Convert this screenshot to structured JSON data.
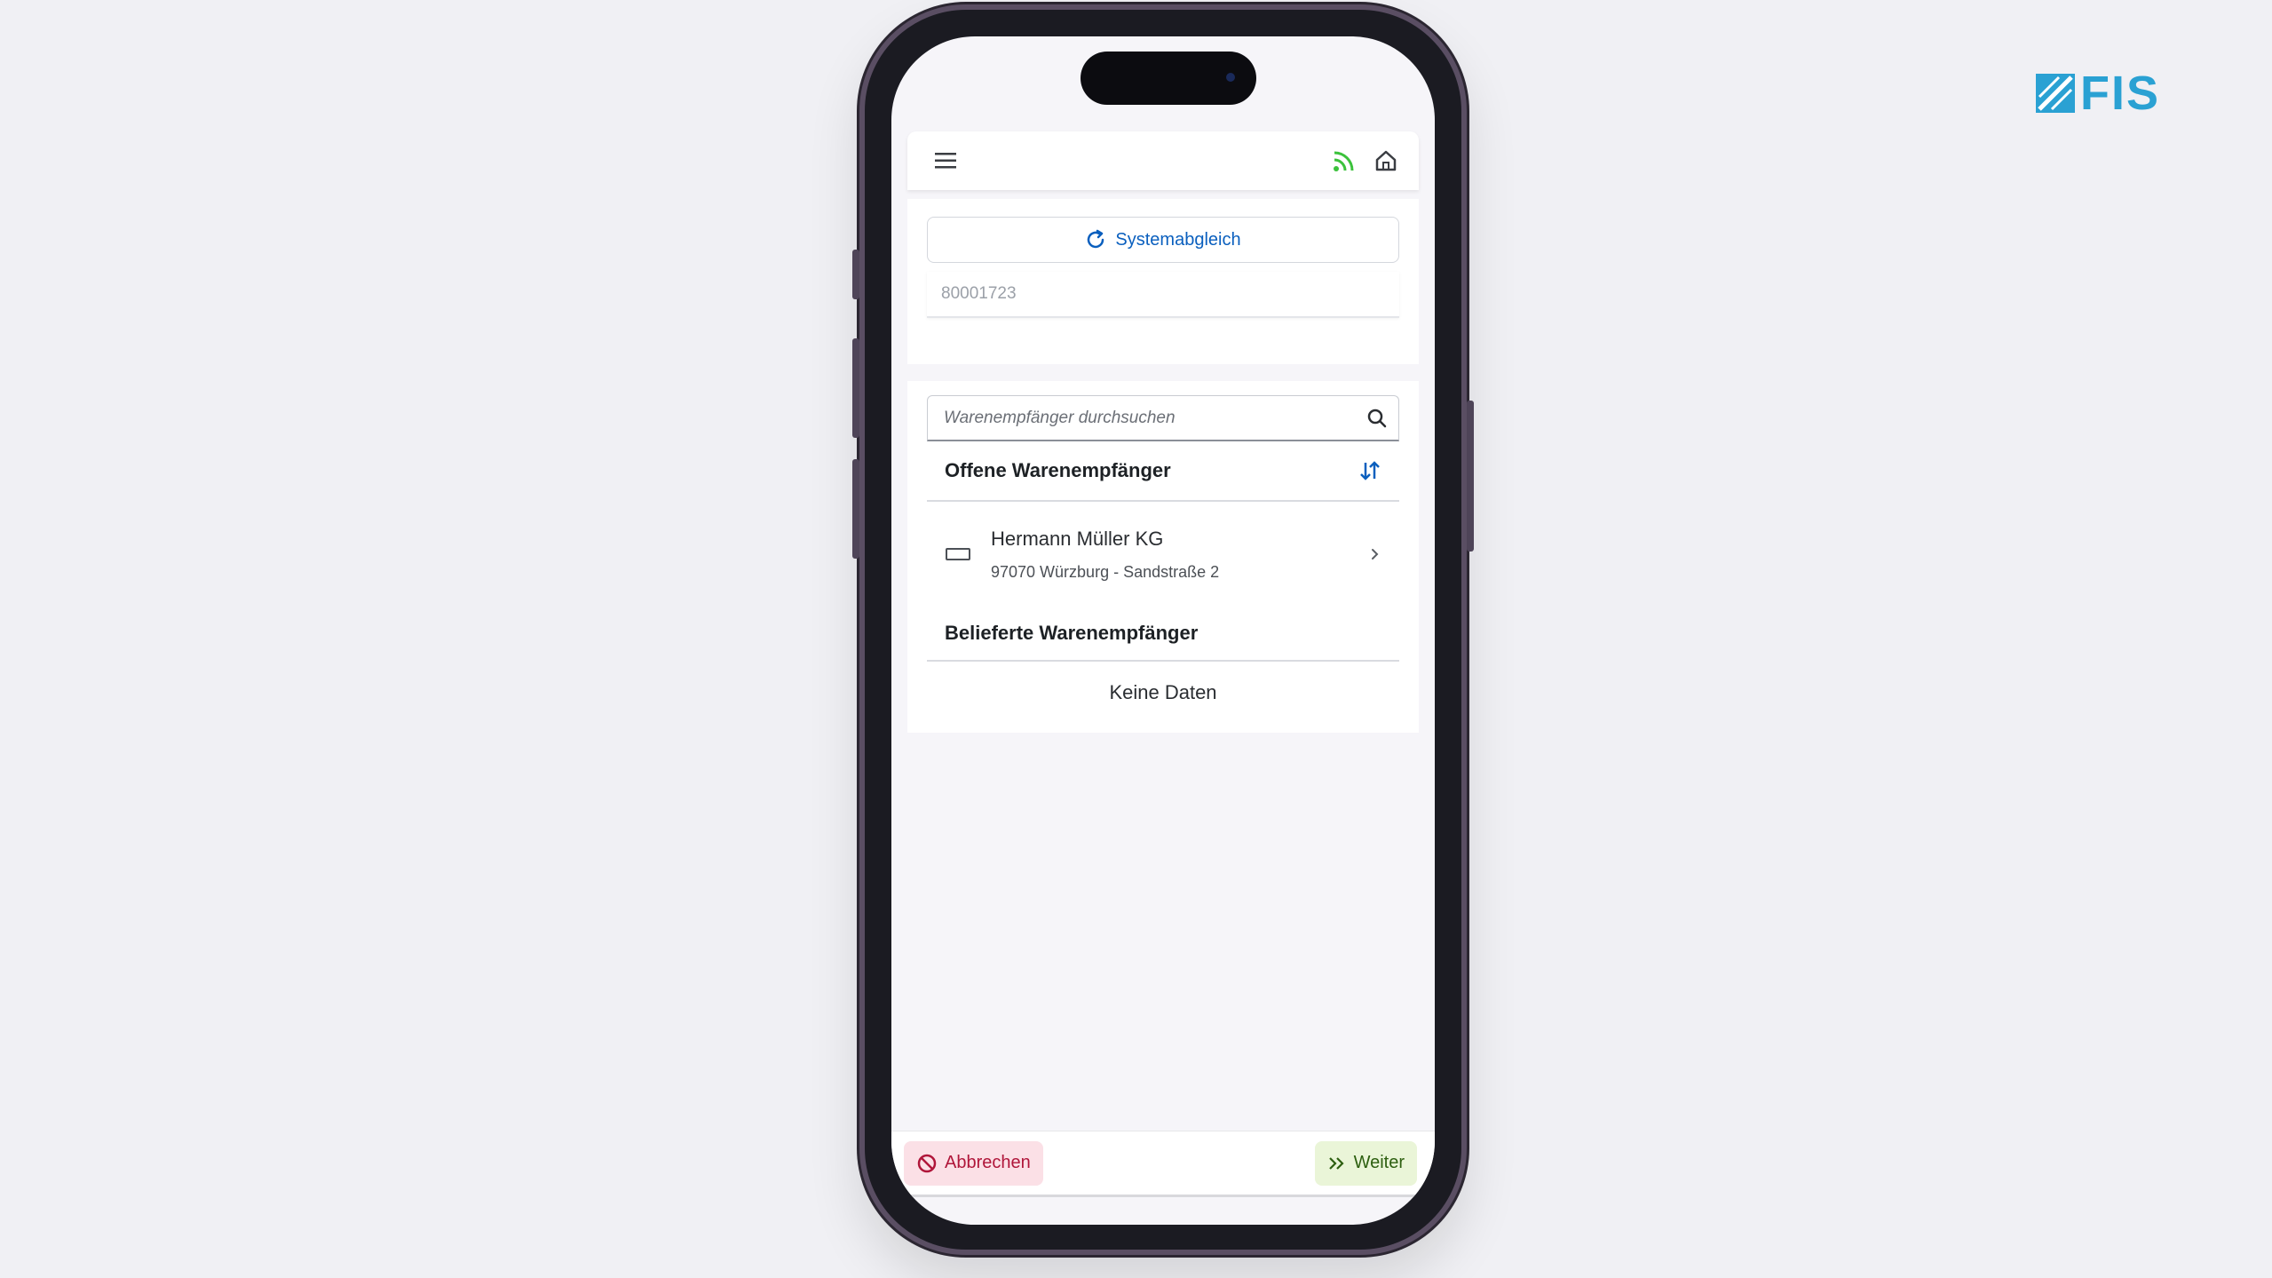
{
  "brand": {
    "name": "FIS"
  },
  "app": {
    "header": {
      "menu_icon": "hamburger-menu-icon",
      "signal_icon": "signal-icon",
      "home_icon": "home-icon"
    },
    "sync_button": {
      "label": "Systemabgleich",
      "icon": "refresh-icon"
    },
    "order_number": "80001723",
    "search": {
      "placeholder": "Warenempfänger durchsuchen",
      "value": ""
    },
    "open_section": {
      "title": "Offene Warenempfänger",
      "items": [
        {
          "name": "Hermann Müller KG",
          "address": "97070 Würzburg - Sandstraße 2"
        }
      ]
    },
    "delivered_section": {
      "title": "Belieferte Warenempfänger",
      "empty_text": "Keine Daten"
    },
    "footer": {
      "cancel_label": "Abbrechen",
      "next_label": "Weiter"
    }
  },
  "colors": {
    "accent": "#0a5fbe",
    "brand": "#2aa1d3",
    "signal": "#3cc23c",
    "cancel_bg": "#fbe0e6",
    "cancel_text": "#b0163a",
    "next_bg": "#eaf5d8",
    "next_text": "#2d5f10"
  }
}
